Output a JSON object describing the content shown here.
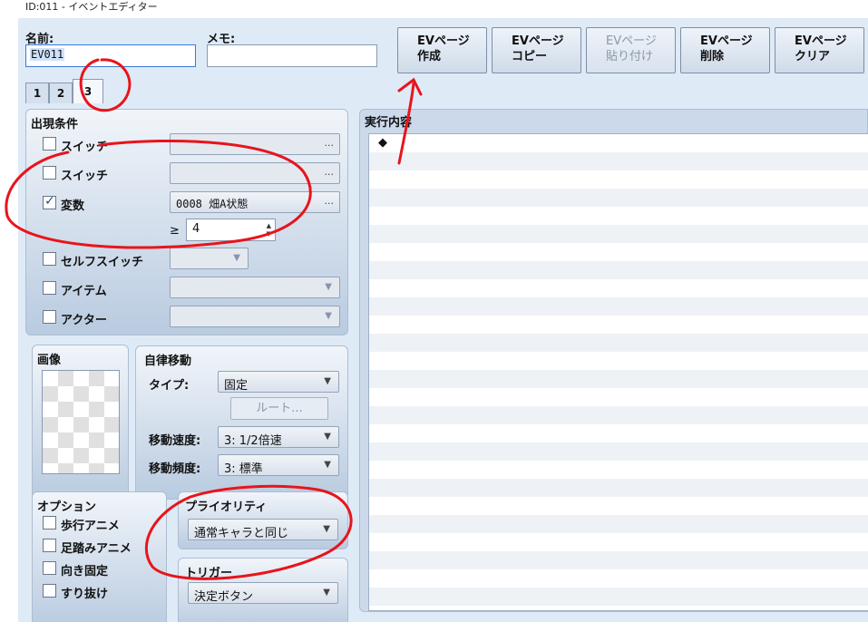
{
  "window": {
    "title": "ID:011 - イベントエディター"
  },
  "header": {
    "name_label": "名前:",
    "name_value": "EV011",
    "memo_label": "メモ:",
    "memo_value": ""
  },
  "toolbar": {
    "buttons": [
      {
        "line1": "EVページ",
        "line2": "作成"
      },
      {
        "line1": "EVページ",
        "line2": "コピー"
      },
      {
        "line1": "EVページ",
        "line2": "貼り付け"
      },
      {
        "line1": "EVページ",
        "line2": "削除"
      },
      {
        "line1": "EVページ",
        "line2": "クリア"
      }
    ]
  },
  "tabs": [
    "1",
    "2",
    "3"
  ],
  "conditions": {
    "title": "出現条件",
    "switch1": {
      "label": "スイッチ",
      "checked": false,
      "value": "",
      "button": "..."
    },
    "switch2": {
      "label": "スイッチ",
      "checked": false,
      "value": "",
      "button": "..."
    },
    "variable": {
      "label": "変数",
      "checked": true,
      "value": "0008 畑A状態",
      "button": "..."
    },
    "variable_op": "≥",
    "variable_amount": "4",
    "self_switch": {
      "label": "セルフスイッチ",
      "checked": false,
      "value": ""
    },
    "item": {
      "label": "アイテム",
      "checked": false,
      "value": ""
    },
    "actor": {
      "label": "アクター",
      "checked": false,
      "value": ""
    }
  },
  "image": {
    "title": "画像"
  },
  "autonomous": {
    "title": "自律移動",
    "type_label": "タイプ:",
    "type_value": "固定",
    "route_button": "ルート...",
    "speed_label": "移動速度:",
    "speed_value": "3: 1/2倍速",
    "freq_label": "移動頻度:",
    "freq_value": "3: 標準"
  },
  "options": {
    "title": "オプション",
    "items": [
      {
        "label": "歩行アニメ",
        "checked": false
      },
      {
        "label": "足踏みアニメ",
        "checked": false
      },
      {
        "label": "向き固定",
        "checked": false
      },
      {
        "label": "すり抜け",
        "checked": false
      }
    ]
  },
  "priority": {
    "title": "プライオリティ",
    "value": "通常キャラと同じ"
  },
  "trigger": {
    "title": "トリガー",
    "value": "決定ボタン"
  },
  "contents": {
    "title": "実行内容",
    "first_row": "◆"
  },
  "colors": {
    "annotation": "#e8141c",
    "panel_bg": "#dfeaf7",
    "accent": "#3b79d1"
  }
}
